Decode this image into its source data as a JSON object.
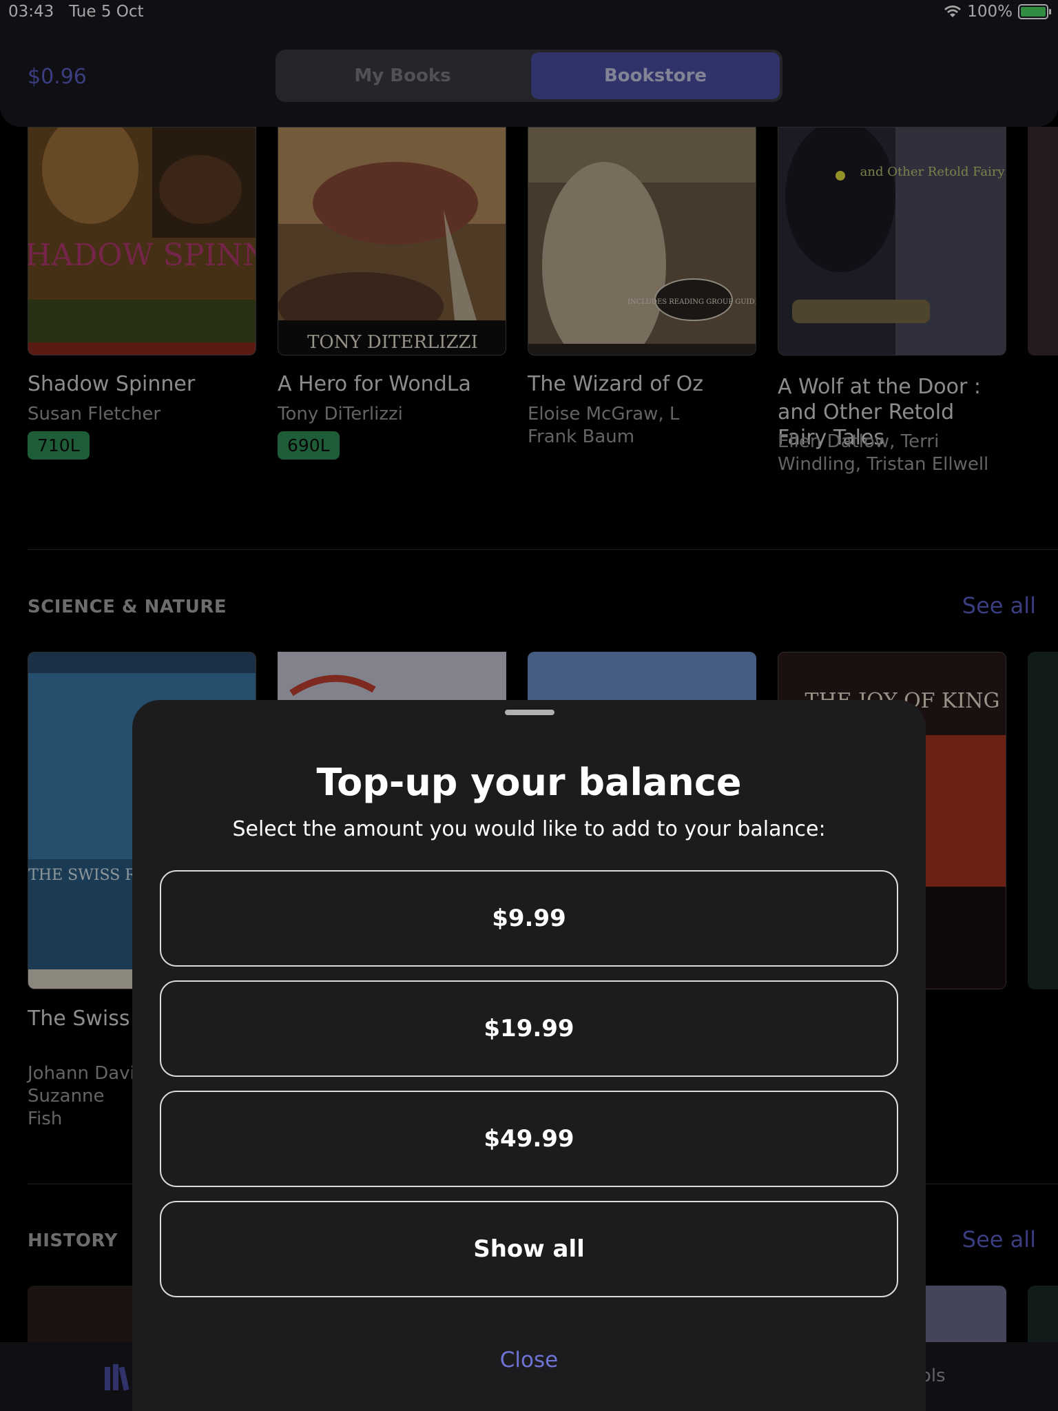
{
  "status_bar": {
    "time": "03:43",
    "date": "Tue 5 Oct",
    "battery": "100%"
  },
  "header": {
    "balance": "$0.96",
    "tabs": [
      {
        "label": "My Books",
        "active": false
      },
      {
        "label": "Bookstore",
        "active": true
      }
    ]
  },
  "row_top": {
    "books": [
      {
        "title": "Shadow Spinner",
        "author": "Susan Fletcher",
        "lexile": "710L"
      },
      {
        "title": "A Hero for WondLa",
        "author": "Tony DiTerlizzi",
        "lexile": "690L"
      },
      {
        "title": "The Wizard of Oz",
        "author": "Eloise McGraw, L Frank Baum"
      },
      {
        "title": "A Wolf at the Door : and Other Retold Fairy Tales",
        "author": "Ellen Datlow, Terri Windling, Tristan Ellwell"
      }
    ],
    "cover_art": {
      "shadow_spinner": "SHADOW SPINNER",
      "hero_wondla": "TONY DITERLIZZI",
      "wizard_oz": "INCLUDES READING GROUP GUIDE",
      "wolf_door": "and Other Retold Fairy Tales"
    }
  },
  "science_nature": {
    "title": "SCIENCE & NATURE",
    "see_all": "See all",
    "books": [
      {
        "title": "The Swiss Family Rob",
        "author": "Johann Davi Suzanne Fish"
      }
    ],
    "cover_art": {
      "swiss_family": "THE SWISS ROBI",
      "joy_of": "THE JOY OF KING"
    }
  },
  "history": {
    "title": "HISTORY",
    "see_all": "See all"
  },
  "tab_bar": {
    "tools_label": "ools"
  },
  "modal": {
    "heading": "Top-up your balance",
    "subtitle": "Select the amount you would like to add to your balance:",
    "options": [
      "$9.99",
      "$19.99",
      "$49.99",
      "Show all"
    ],
    "close_label": "Close"
  },
  "colors": {
    "accent": "#5b5ec6",
    "lexile_badge": "#2f8f55",
    "sheet_bg": "#1c1c1e"
  }
}
